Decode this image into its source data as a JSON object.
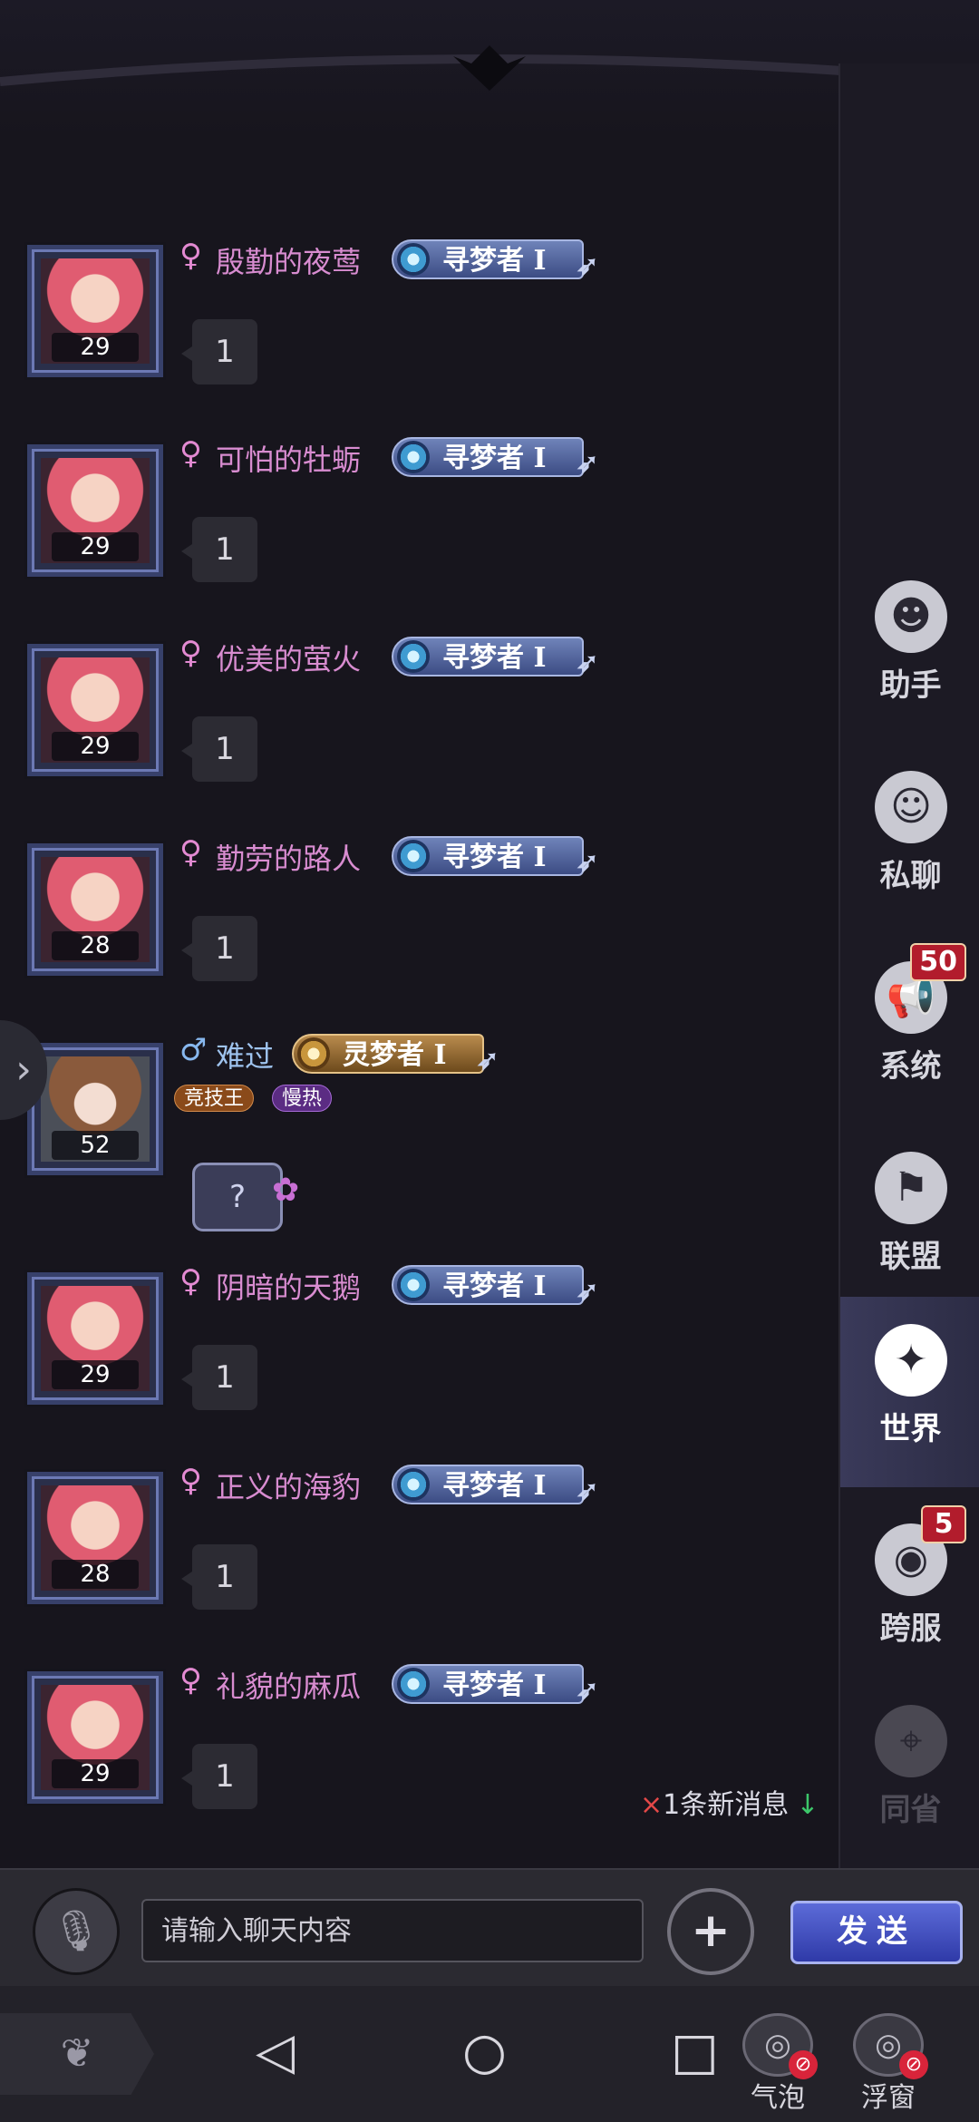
{
  "messages": [
    {
      "gender": "♀",
      "name": "殷勤的夜莺",
      "rank": "寻梦者 I",
      "level": "29",
      "text": "1"
    },
    {
      "gender": "♀",
      "name": "可怕的牡蛎",
      "rank": "寻梦者 I",
      "level": "29",
      "text": "1"
    },
    {
      "gender": "♀",
      "name": "优美的萤火",
      "rank": "寻梦者 I",
      "level": "29",
      "text": "1"
    },
    {
      "gender": "♀",
      "name": "勤劳的路人",
      "rank": "寻梦者 I",
      "level": "28",
      "text": "1"
    },
    {
      "gender": "♂",
      "name": "难过",
      "rank": "灵梦者 I",
      "level": "52",
      "tags": [
        "竞技王",
        "慢热"
      ],
      "text": "?"
    },
    {
      "gender": "♀",
      "name": "阴暗的天鹅",
      "rank": "寻梦者 I",
      "level": "29",
      "text": "1"
    },
    {
      "gender": "♀",
      "name": "正义的海豹",
      "rank": "寻梦者 I",
      "level": "28",
      "text": "1"
    },
    {
      "gender": "♀",
      "name": "礼貌的麻瓜",
      "rank": "寻梦者 I",
      "level": "29",
      "text": "1"
    }
  ],
  "new_message_notice": {
    "x": "×",
    "text": "1条新消息",
    "arrow": "↓"
  },
  "sidenav": [
    {
      "label": "助手",
      "icon": "assistant-icon",
      "badge": ""
    },
    {
      "label": "私聊",
      "icon": "private-chat-icon",
      "badge": ""
    },
    {
      "label": "系统",
      "icon": "megaphone-icon",
      "badge": "50"
    },
    {
      "label": "联盟",
      "icon": "alliance-banner-icon",
      "badge": ""
    },
    {
      "label": "世界",
      "icon": "world-compass-icon",
      "badge": "",
      "active": true
    },
    {
      "label": "跨服",
      "icon": "cross-server-icon",
      "badge": "5"
    },
    {
      "label": "同省",
      "icon": "location-pin-icon",
      "badge": "",
      "disabled": true
    }
  ],
  "input": {
    "placeholder": "请输入聊天内容",
    "send_label": "发送"
  },
  "system_bar": {
    "bubble_label": "气泡",
    "float_label": "浮窗"
  },
  "colors": {
    "background": "#17151d",
    "female_name": "#d88cd0",
    "male_name": "#9ec3ee",
    "active_nav": "#3a3a5a",
    "badge": "#b21c2c",
    "send": "#3f4bc0"
  }
}
